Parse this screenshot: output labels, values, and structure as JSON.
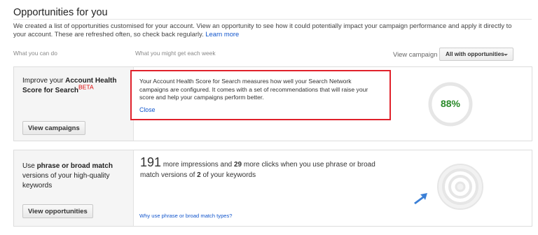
{
  "page": {
    "title": "Opportunities for you",
    "intro_text": "We created a list of opportunities customised for your account. View an opportunity to see how it could potentially impact your campaign performance and apply it directly to your account. These are refreshed often, so check back regularly.",
    "learn_more": "Learn more"
  },
  "columns": {
    "left": "What you can do",
    "middle": "What you might get each week"
  },
  "filter": {
    "label": "View campaign",
    "selected": "All with opportunities"
  },
  "card1": {
    "heading_prefix": "Improve your ",
    "heading_bold": "Account Health Score for Search",
    "badge": "BETA",
    "button": "View campaigns",
    "callout_text": "Your Account Health Score for Search measures how well your Search Network campaigns are configured. It comes with a set of recommendations that will raise your score and help your campaigns perform better.",
    "close": "Close",
    "score_text": "88%",
    "score_value": 88,
    "score_color": "#2a8a2a"
  },
  "card2": {
    "heading_prefix": "Use ",
    "heading_bold": "phrase or broad match",
    "heading_suffix": " versions of your high-quality keywords",
    "button": "View opportunities",
    "impressions": "191",
    "impressions_label": " more impressions and ",
    "clicks": "29",
    "clicks_label": " more clicks when you use phrase or broad match versions of ",
    "keywords": "2",
    "keywords_label": " of your keywords",
    "link": "Why use phrase or broad match types?",
    "icon": "target-icon"
  },
  "colors": {
    "link": "#1155cc",
    "highlight_border": "#e0212b",
    "arrow": "#3b7fd6"
  }
}
